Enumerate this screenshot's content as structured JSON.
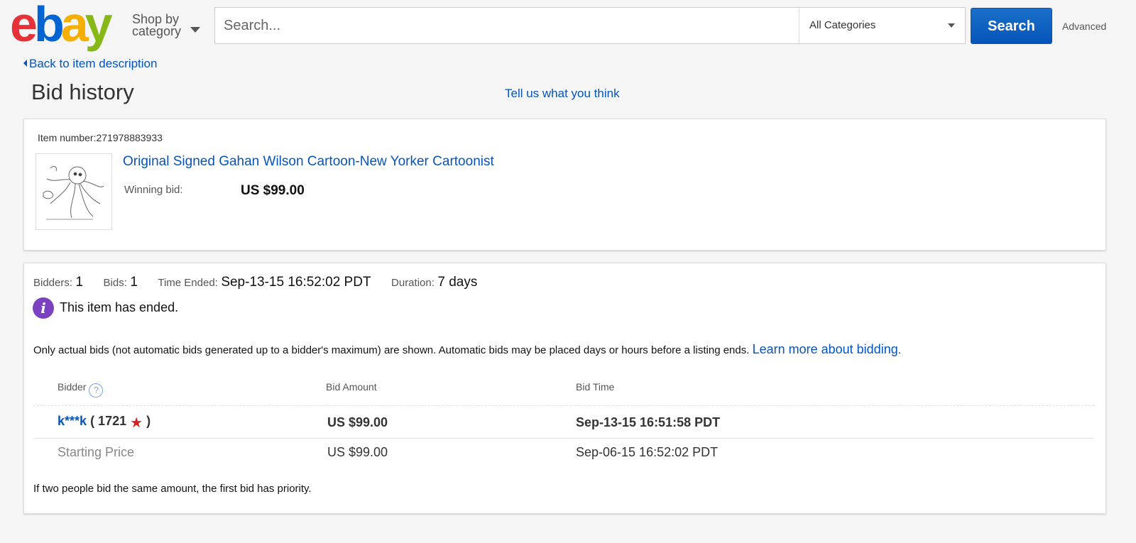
{
  "header": {
    "logo": {
      "e": "e",
      "b": "b",
      "a": "a",
      "y": "y"
    },
    "shop_by_line1": "Shop by",
    "shop_by_line2": "category",
    "search_placeholder": "Search...",
    "category_selected": "All Categories",
    "search_button": "Search",
    "advanced_link": "Advanced"
  },
  "nav": {
    "back_link": "Back to item description"
  },
  "page": {
    "title": "Bid history",
    "feedback_link": "Tell us what you think"
  },
  "item": {
    "number_label": "Item number:",
    "number_value": "271978883933",
    "title": "Original Signed Gahan Wilson Cartoon-New Yorker Cartoonist",
    "winning_bid_label": "Winning bid:",
    "winning_bid_value": "US $99.00"
  },
  "summary": {
    "bidders_label": "Bidders:",
    "bidders_value": "1",
    "bids_label": "Bids:",
    "bids_value": "1",
    "time_ended_label": "Time Ended:",
    "time_ended_value": "Sep-13-15 16:52:02 PDT",
    "duration_label": "Duration:",
    "duration_value": "7 days",
    "ended_message": "This item has ended.",
    "note_text": "Only actual bids (not automatic bids generated up to a bidder's maximum) are shown. Automatic bids may be placed days or hours before a listing ends.",
    "learn_more_link": "Learn more about bidding",
    "note_period": "."
  },
  "table": {
    "headers": {
      "bidder": "Bidder",
      "amount": "Bid Amount",
      "time": "Bid Time"
    },
    "help_glyph": "?",
    "bid_row": {
      "bidder": "k***k",
      "feedback_open": "( 1721",
      "feedback_close": ")",
      "star_icon": "red-star-icon",
      "amount": "US $99.00",
      "time": "Sep-13-15 16:51:58 PDT"
    },
    "starting_row": {
      "label": "Starting Price",
      "amount": "US $99.00",
      "time": "Sep-06-15 16:52:02 PDT"
    }
  },
  "footer_note": "If two people bid the same amount, the first bid has priority.",
  "colors": {
    "link": "#0654ba",
    "search_button": "#0654ba",
    "info_icon": "#7a42c0",
    "star": "#d91e1e"
  }
}
